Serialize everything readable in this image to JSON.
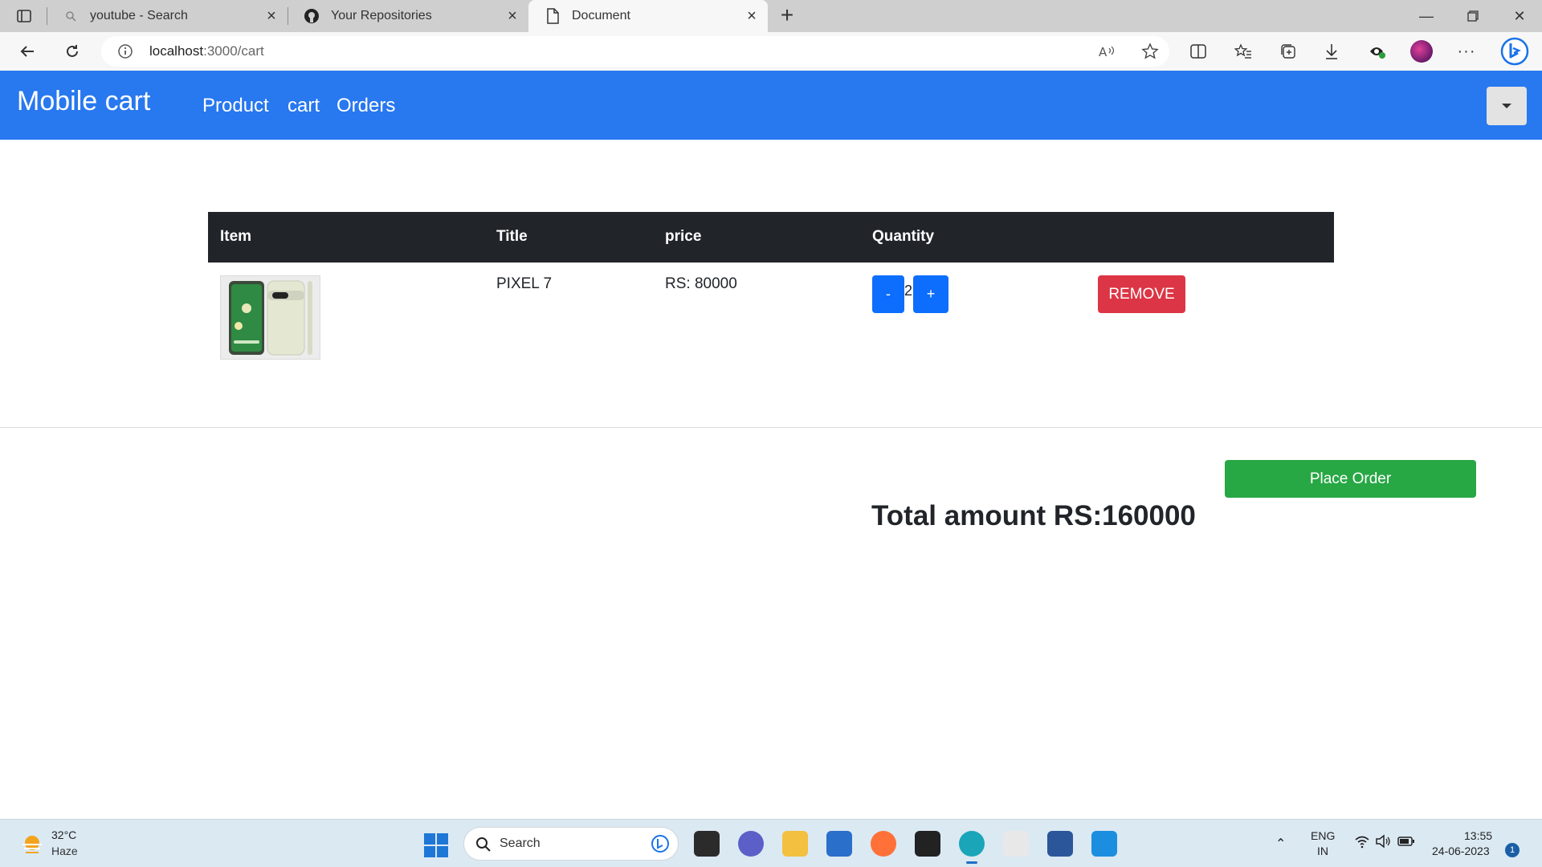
{
  "browser": {
    "tabs": [
      {
        "title": "youtube - Search",
        "icon": "search-icon"
      },
      {
        "title": "Your Repositories",
        "icon": "github-icon"
      },
      {
        "title": "Document",
        "icon": "document-icon"
      }
    ],
    "address": {
      "host": "localhost",
      "path": ":3000/cart"
    }
  },
  "app": {
    "brand": "Mobile cart",
    "nav": [
      "Product",
      "cart",
      "Orders"
    ],
    "colors": {
      "navbar": "#2878ef",
      "table_header": "#212529",
      "primary": "#0d6efd",
      "danger": "#dc3545",
      "success": "#28a745"
    }
  },
  "cart": {
    "columns": [
      "Item",
      "Title",
      "price",
      "Quantity"
    ],
    "items": [
      {
        "title": "PIXEL 7",
        "price": "RS: 80000",
        "decrement_label": "-",
        "quantity": "2",
        "increment_label": "+",
        "remove_label": "REMOVE"
      }
    ],
    "place_order_label": "Place Order",
    "total": "Total amount RS:160000"
  },
  "taskbar": {
    "weather": {
      "temp": "32°C",
      "condition": "Haze"
    },
    "search_label": "Search",
    "language": [
      "ENG",
      "IN"
    ],
    "time": "13:55",
    "date": "24-06-2023",
    "notifications": "1"
  }
}
